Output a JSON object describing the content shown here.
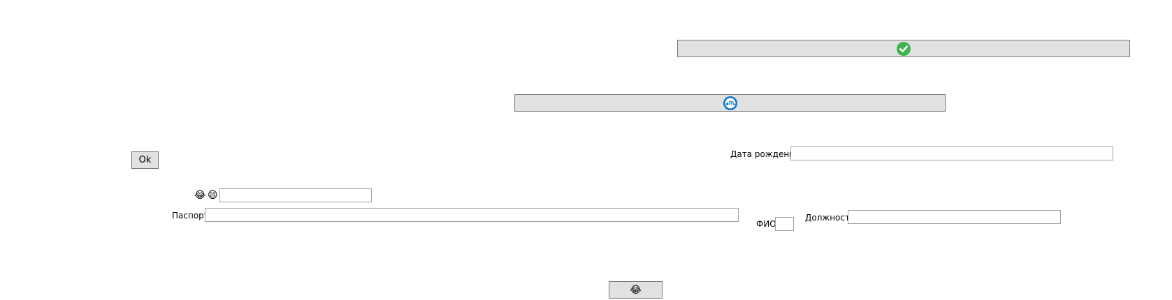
{
  "buttons": {
    "check_button": {
      "icon": "green-checkmark-icon",
      "color": "#3fb34f"
    },
    "cloud_button": {
      "icon": "blue-cloud-refresh-icon",
      "color": "#0a74c9"
    },
    "ok_button": {
      "label": "Ok"
    },
    "bottom_button": {
      "icon": "laughing-face-emoji",
      "glyph": "😂"
    }
  },
  "form": {
    "birth_date": {
      "label": "Дата рождения",
      "value": ""
    },
    "emoji_field": {
      "icons": [
        "😂",
        "😄"
      ],
      "value": ""
    },
    "passport": {
      "label": "Паспорт",
      "value": ""
    },
    "fio": {
      "label": "ФИО",
      "value": ""
    },
    "position": {
      "label": "Должность",
      "value": ""
    }
  }
}
